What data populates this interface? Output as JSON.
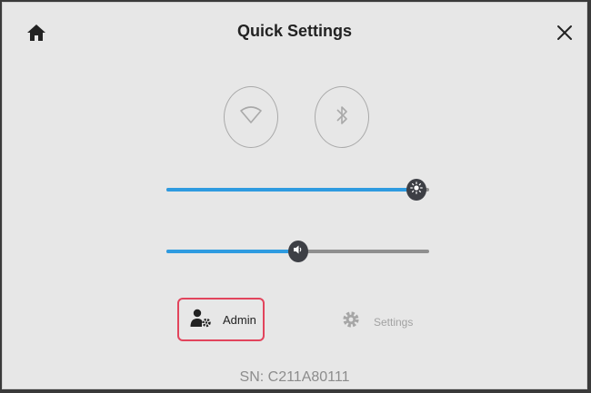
{
  "header": {
    "title": "Quick Settings",
    "home_icon": "home-icon",
    "close_icon": "close-icon"
  },
  "toggles": [
    {
      "icon": "wifi-icon",
      "state": "off"
    },
    {
      "icon": "bluetooth-icon",
      "state": "off"
    }
  ],
  "sliders": {
    "brightness": {
      "icon": "brightness-icon",
      "value": 0.95
    },
    "volume": {
      "icon": "volume-icon",
      "value": 0.5
    }
  },
  "footer": {
    "admin_label": "Admin",
    "settings_label": "Settings",
    "serial": "SN: C211A80111"
  },
  "colors": {
    "accent": "#2e9be0",
    "highlight_border": "#e2445c",
    "knob": "#3d3f45",
    "background": "#e7e7e7"
  }
}
